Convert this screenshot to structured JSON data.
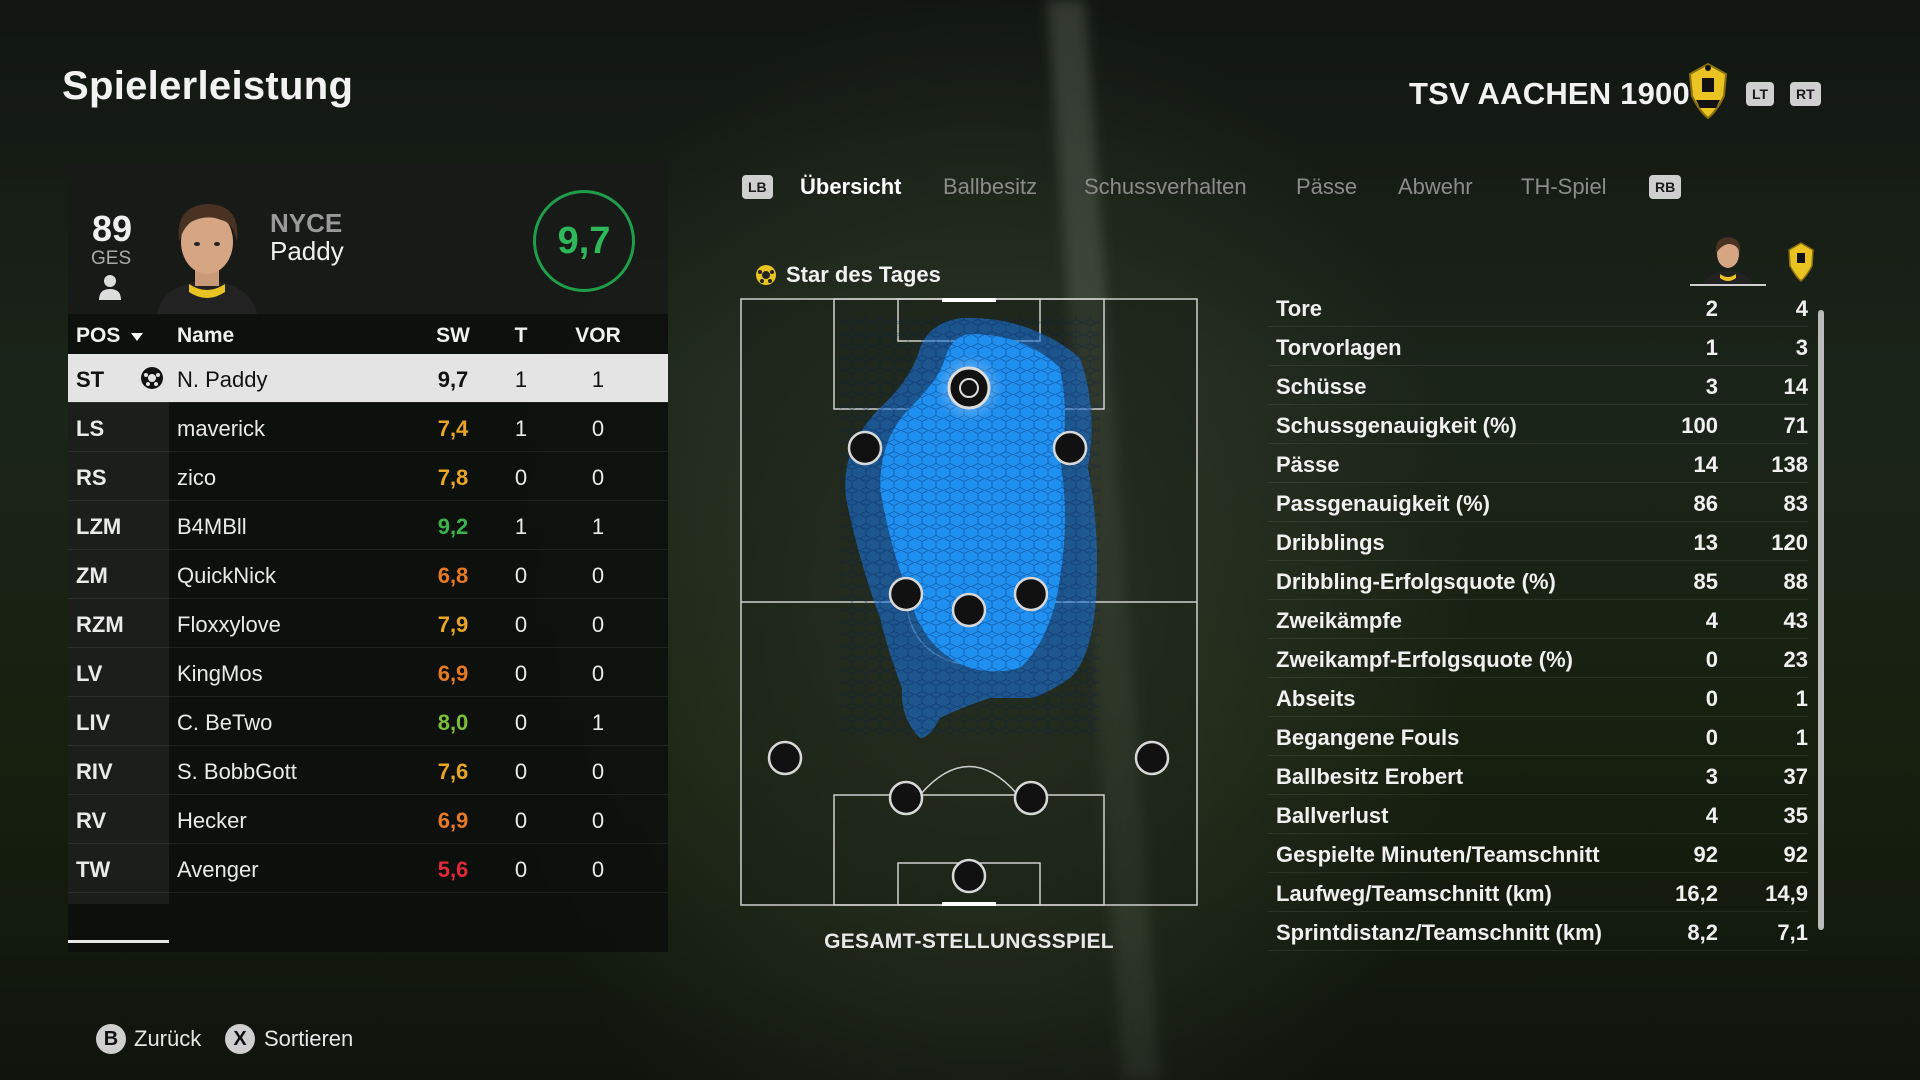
{
  "page": {
    "title": "Spielerleistung"
  },
  "team": {
    "name": "TSV AACHEN 1900",
    "lt_label": "LT",
    "rt_label": "RT",
    "crest_color": "#e8c322"
  },
  "player_card": {
    "overall": "89",
    "overall_label": "GES",
    "gamer_tag": "NYCE",
    "name": "Paddy",
    "match_rating": "9,7",
    "rating_color": "#2fb85a"
  },
  "table": {
    "headers": {
      "pos": "POS",
      "name": "Name",
      "sw": "SW",
      "t": "T",
      "vor": "VOR"
    },
    "rows": [
      {
        "pos": "ST",
        "name": "N. Paddy",
        "sw": "9,7",
        "t": "1",
        "vor": "1",
        "color": "#111111",
        "selected": true,
        "star": true
      },
      {
        "pos": "LS",
        "name": "maverick",
        "sw": "7,4",
        "t": "1",
        "vor": "0",
        "color": "#e8a623"
      },
      {
        "pos": "RS",
        "name": "zico",
        "sw": "7,8",
        "t": "0",
        "vor": "0",
        "color": "#e8a623"
      },
      {
        "pos": "LZM",
        "name": "B4MBll",
        "sw": "9,2",
        "t": "1",
        "vor": "1",
        "color": "#3ab34a"
      },
      {
        "pos": "ZM",
        "name": "QuickNick",
        "sw": "6,8",
        "t": "0",
        "vor": "0",
        "color": "#e87a23"
      },
      {
        "pos": "RZM",
        "name": "Floxxylove",
        "sw": "7,9",
        "t": "0",
        "vor": "0",
        "color": "#e8a623"
      },
      {
        "pos": "LV",
        "name": "KingMos",
        "sw": "6,9",
        "t": "0",
        "vor": "0",
        "color": "#e87a23"
      },
      {
        "pos": "LIV",
        "name": "C. BeTwo",
        "sw": "8,0",
        "t": "0",
        "vor": "1",
        "color": "#7cbf3a"
      },
      {
        "pos": "RIV",
        "name": "S. BobbGott",
        "sw": "7,6",
        "t": "0",
        "vor": "0",
        "color": "#e8a623"
      },
      {
        "pos": "RV",
        "name": "Hecker",
        "sw": "6,9",
        "t": "0",
        "vor": "0",
        "color": "#e87a23"
      },
      {
        "pos": "TW",
        "name": "Avenger",
        "sw": "5,6",
        "t": "0",
        "vor": "0",
        "color": "#e0283a"
      }
    ]
  },
  "tabs": {
    "lb_label": "LB",
    "rb_label": "RB",
    "items": [
      "Übersicht",
      "Ballbesitz",
      "Schussverhalten",
      "Pässe",
      "Abwehr",
      "TH-Spiel"
    ],
    "active": "Übersicht"
  },
  "pitch": {
    "star_label": "Star des Tages",
    "caption": "GESAMT-STELLUNGSSPIEL",
    "heat_color": "#1f8ff0"
  },
  "stats": {
    "rows": [
      {
        "label": "Tore",
        "player": "2",
        "team": "4"
      },
      {
        "label": "Torvorlagen",
        "player": "1",
        "team": "3"
      },
      {
        "label": "Schüsse",
        "player": "3",
        "team": "14"
      },
      {
        "label": "Schussgenauigkeit (%)",
        "player": "100",
        "team": "71"
      },
      {
        "label": "Pässe",
        "player": "14",
        "team": "138"
      },
      {
        "label": "Passgenauigkeit (%)",
        "player": "86",
        "team": "83"
      },
      {
        "label": "Dribblings",
        "player": "13",
        "team": "120"
      },
      {
        "label": "Dribbling-Erfolgsquote (%)",
        "player": "85",
        "team": "88"
      },
      {
        "label": "Zweikämpfe",
        "player": "4",
        "team": "43"
      },
      {
        "label": "Zweikampf-Erfolgsquote (%)",
        "player": "0",
        "team": "23"
      },
      {
        "label": "Abseits",
        "player": "0",
        "team": "1"
      },
      {
        "label": "Begangene Fouls",
        "player": "0",
        "team": "1"
      },
      {
        "label": "Ballbesitz Erobert",
        "player": "3",
        "team": "37"
      },
      {
        "label": "Ballverlust",
        "player": "4",
        "team": "35"
      },
      {
        "label": "Gespielte Minuten/Teamschnitt",
        "player": "92",
        "team": "92"
      },
      {
        "label": "Laufweg/Teamschnitt (km)",
        "player": "16,2",
        "team": "14,9"
      },
      {
        "label": "Sprintdistanz/Teamschnitt (km)",
        "player": "8,2",
        "team": "7,1"
      }
    ]
  },
  "footer": {
    "back": {
      "button": "B",
      "label": "Zurück"
    },
    "sort": {
      "button": "X",
      "label": "Sortieren"
    }
  }
}
